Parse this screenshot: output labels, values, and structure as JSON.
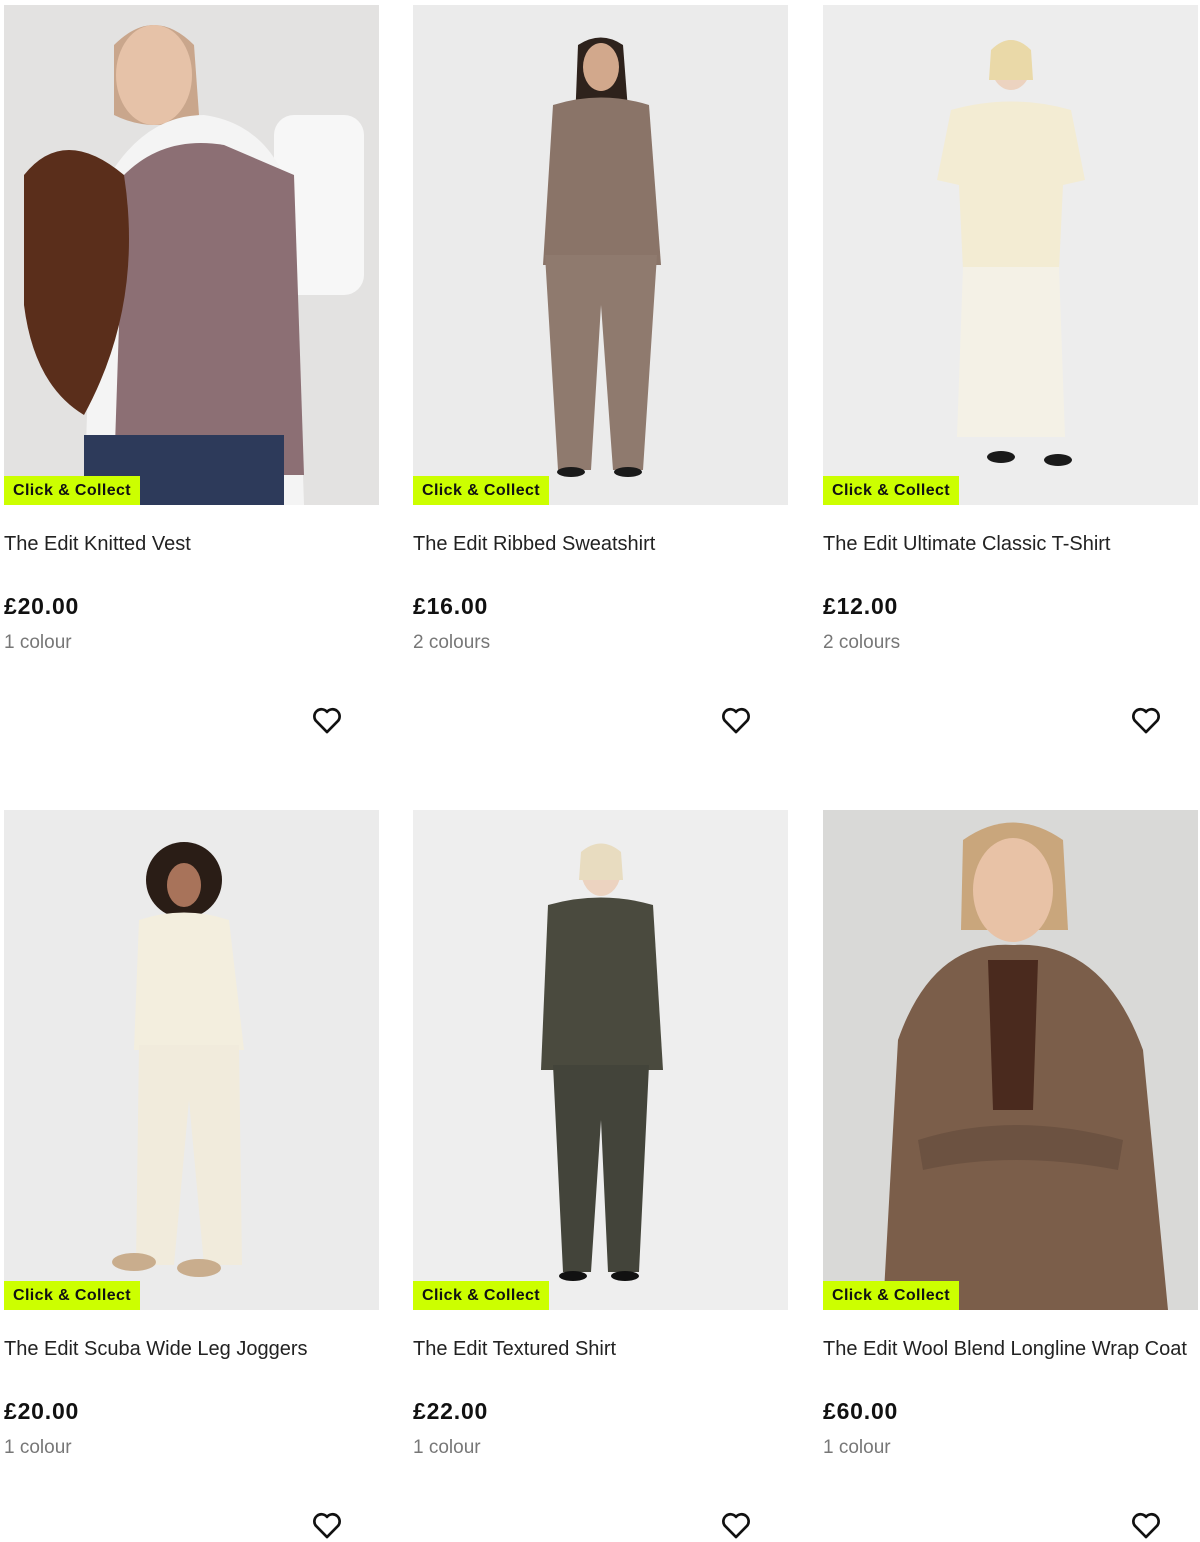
{
  "products": [
    {
      "name": "The Edit Knitted Vest",
      "price": "£20.00",
      "colours": "1 colour",
      "badge": "Click & Collect",
      "image_alt": "Woman wearing a marled knitted vest over a white t-shirt, holding a brown suede bag"
    },
    {
      "name": "The Edit Ribbed Sweatshirt",
      "price": "£16.00",
      "colours": "2 colours",
      "badge": "Click & Collect",
      "image_alt": "Woman in a taupe ribbed sweatshirt and wide-leg trousers"
    },
    {
      "name": "The Edit Ultimate Classic T-Shirt",
      "price": "£12.00",
      "colours": "2 colours",
      "badge": "Click & Collect",
      "image_alt": "Woman in a cream oversized t-shirt and long cream skirt"
    },
    {
      "name": "The Edit Scuba Wide Leg Joggers",
      "price": "£20.00",
      "colours": "1 colour",
      "badge": "Click & Collect",
      "image_alt": "Woman in a cream hoodie and cream wide leg joggers"
    },
    {
      "name": "The Edit Textured Shirt",
      "price": "£22.00",
      "colours": "1 colour",
      "badge": "Click & Collect",
      "image_alt": "Woman in a dark textured shirt and matching trousers"
    },
    {
      "name": "The Edit Wool Blend Longline Wrap Coat",
      "price": "£60.00",
      "colours": "1 colour",
      "badge": "Click & Collect",
      "image_alt": "Woman in a brown wool blend longline wrap coat"
    }
  ],
  "colors": {
    "badge_bg": "#ccff00",
    "price_text": "#111111",
    "colours_text": "#777777"
  },
  "icons": {
    "wishlist": "heart-outline-icon"
  }
}
